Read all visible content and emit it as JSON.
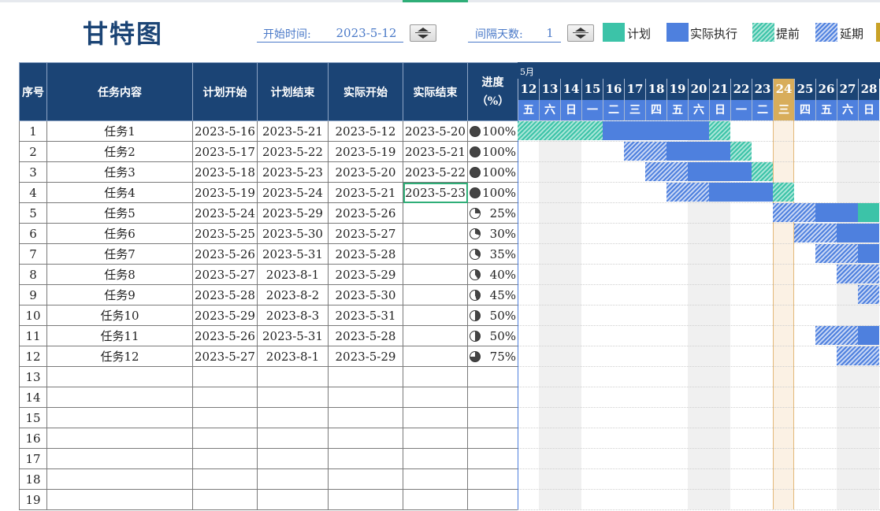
{
  "title": "甘特图",
  "controls": {
    "start_label": "开始时间:",
    "start_value": "2023-5-12",
    "interval_label": "间隔天数:",
    "interval_value": "1"
  },
  "legend": [
    {
      "label": "计划",
      "kind": "plan"
    },
    {
      "label": "实际执行",
      "kind": "actual"
    },
    {
      "label": "提前",
      "kind": "early"
    },
    {
      "label": "延期",
      "kind": "delay"
    }
  ],
  "colors": {
    "header": "#1b4475",
    "plan": "#3cc3a8",
    "actual": "#4e80de",
    "today": "#d8ad5b"
  },
  "columns": [
    "序号",
    "任务内容",
    "计划开始",
    "计划结束",
    "实际开始",
    "实际结束",
    "进度\n（%）"
  ],
  "rows": [
    {
      "no": "1",
      "task": "任务1",
      "ps": "2023-5-16",
      "pe": "2023-5-21",
      "as": "2023-5-12",
      "ae": "2023-5-20",
      "pct": "100%",
      "p": 1.0
    },
    {
      "no": "2",
      "task": "任务2",
      "ps": "2023-5-17",
      "pe": "2023-5-22",
      "as": "2023-5-19",
      "ae": "2023-5-21",
      "pct": "100%",
      "p": 1.0
    },
    {
      "no": "3",
      "task": "任务3",
      "ps": "2023-5-18",
      "pe": "2023-5-23",
      "as": "2023-5-20",
      "ae": "2023-5-22",
      "pct": "100%",
      "p": 1.0
    },
    {
      "no": "4",
      "task": "任务4",
      "ps": "2023-5-19",
      "pe": "2023-5-24",
      "as": "2023-5-21",
      "ae": "2023-5-23",
      "pct": "100%",
      "p": 1.0
    },
    {
      "no": "5",
      "task": "任务5",
      "ps": "2023-5-24",
      "pe": "2023-5-29",
      "as": "2023-5-26",
      "ae": "",
      "pct": "25%",
      "p": 0.25
    },
    {
      "no": "6",
      "task": "任务6",
      "ps": "2023-5-25",
      "pe": "2023-5-30",
      "as": "2023-5-27",
      "ae": "",
      "pct": "30%",
      "p": 0.3
    },
    {
      "no": "7",
      "task": "任务7",
      "ps": "2023-5-26",
      "pe": "2023-5-31",
      "as": "2023-5-28",
      "ae": "",
      "pct": "35%",
      "p": 0.35
    },
    {
      "no": "8",
      "task": "任务8",
      "ps": "2023-5-27",
      "pe": "2023-8-1",
      "as": "2023-5-29",
      "ae": "",
      "pct": "40%",
      "p": 0.4
    },
    {
      "no": "9",
      "task": "任务9",
      "ps": "2023-5-28",
      "pe": "2023-8-2",
      "as": "2023-5-30",
      "ae": "",
      "pct": "45%",
      "p": 0.45
    },
    {
      "no": "10",
      "task": "任务10",
      "ps": "2023-5-29",
      "pe": "2023-8-3",
      "as": "2023-5-31",
      "ae": "",
      "pct": "50%",
      "p": 0.5
    },
    {
      "no": "11",
      "task": "任务11",
      "ps": "2023-5-26",
      "pe": "2023-5-31",
      "as": "2023-5-28",
      "ae": "",
      "pct": "50%",
      "p": 0.5
    },
    {
      "no": "12",
      "task": "任务12",
      "ps": "2023-5-27",
      "pe": "2023-8-1",
      "as": "2023-5-29",
      "ae": "",
      "pct": "75%",
      "p": 0.75
    },
    {
      "no": "13",
      "task": "",
      "ps": "",
      "pe": "",
      "as": "",
      "ae": "",
      "pct": "",
      "p": null
    },
    {
      "no": "14",
      "task": "",
      "ps": "",
      "pe": "",
      "as": "",
      "ae": "",
      "pct": "",
      "p": null
    },
    {
      "no": "15",
      "task": "",
      "ps": "",
      "pe": "",
      "as": "",
      "ae": "",
      "pct": "",
      "p": null
    },
    {
      "no": "16",
      "task": "",
      "ps": "",
      "pe": "",
      "as": "",
      "ae": "",
      "pct": "",
      "p": null
    },
    {
      "no": "17",
      "task": "",
      "ps": "",
      "pe": "",
      "as": "",
      "ae": "",
      "pct": "",
      "p": null
    },
    {
      "no": "18",
      "task": "",
      "ps": "",
      "pe": "",
      "as": "",
      "ae": "",
      "pct": "",
      "p": null
    },
    {
      "no": "19",
      "task": "",
      "ps": "",
      "pe": "",
      "as": "",
      "ae": "",
      "pct": "",
      "p": null
    }
  ],
  "gantt": {
    "month": "5月",
    "days": [
      "12",
      "13",
      "14",
      "15",
      "16",
      "17",
      "18",
      "19",
      "20",
      "21",
      "22",
      "23",
      "24",
      "25",
      "26",
      "27",
      "28"
    ],
    "weekdays": [
      "五",
      "六",
      "日",
      "一",
      "二",
      "三",
      "四",
      "五",
      "六",
      "日",
      "一",
      "二",
      "三",
      "四",
      "五",
      "六",
      "日"
    ],
    "today": "24",
    "weekend_days": [
      "13",
      "14",
      "20",
      "21",
      "27",
      "28"
    ],
    "bars": [
      {
        "row": 1,
        "segments": [
          {
            "from": "12",
            "to": "15",
            "kind": "early"
          },
          {
            "from": "16",
            "to": "20",
            "kind": "actual"
          },
          {
            "from": "21",
            "to": "21",
            "kind": "early"
          }
        ]
      },
      {
        "row": 2,
        "segments": [
          {
            "from": "17",
            "to": "18",
            "kind": "delay"
          },
          {
            "from": "19",
            "to": "21",
            "kind": "actual"
          },
          {
            "from": "22",
            "to": "22",
            "kind": "early"
          }
        ]
      },
      {
        "row": 3,
        "segments": [
          {
            "from": "18",
            "to": "19",
            "kind": "delay"
          },
          {
            "from": "20",
            "to": "22",
            "kind": "actual"
          },
          {
            "from": "23",
            "to": "23",
            "kind": "early"
          }
        ]
      },
      {
        "row": 4,
        "segments": [
          {
            "from": "19",
            "to": "20",
            "kind": "delay"
          },
          {
            "from": "21",
            "to": "23",
            "kind": "actual"
          },
          {
            "from": "24",
            "to": "24",
            "kind": "early"
          }
        ]
      },
      {
        "row": 5,
        "segments": [
          {
            "from": "24",
            "to": "25",
            "kind": "delay"
          },
          {
            "from": "26",
            "to": "27",
            "kind": "actual"
          },
          {
            "from": "28",
            "to": "28",
            "kind": "plan"
          }
        ]
      },
      {
        "row": 6,
        "segments": [
          {
            "from": "25",
            "to": "26",
            "kind": "delay"
          },
          {
            "from": "27",
            "to": "28",
            "kind": "actual"
          }
        ]
      },
      {
        "row": 7,
        "segments": [
          {
            "from": "26",
            "to": "27",
            "kind": "delay"
          },
          {
            "from": "28",
            "to": "28",
            "kind": "actual"
          }
        ]
      },
      {
        "row": 8,
        "segments": [
          {
            "from": "27",
            "to": "28",
            "kind": "delay"
          }
        ]
      },
      {
        "row": 9,
        "segments": [
          {
            "from": "28",
            "to": "28",
            "kind": "delay"
          }
        ]
      },
      {
        "row": 11,
        "segments": [
          {
            "from": "26",
            "to": "27",
            "kind": "delay"
          },
          {
            "from": "28",
            "to": "28",
            "kind": "actual"
          }
        ]
      },
      {
        "row": 12,
        "segments": [
          {
            "from": "27",
            "to": "28",
            "kind": "delay"
          }
        ]
      }
    ]
  }
}
